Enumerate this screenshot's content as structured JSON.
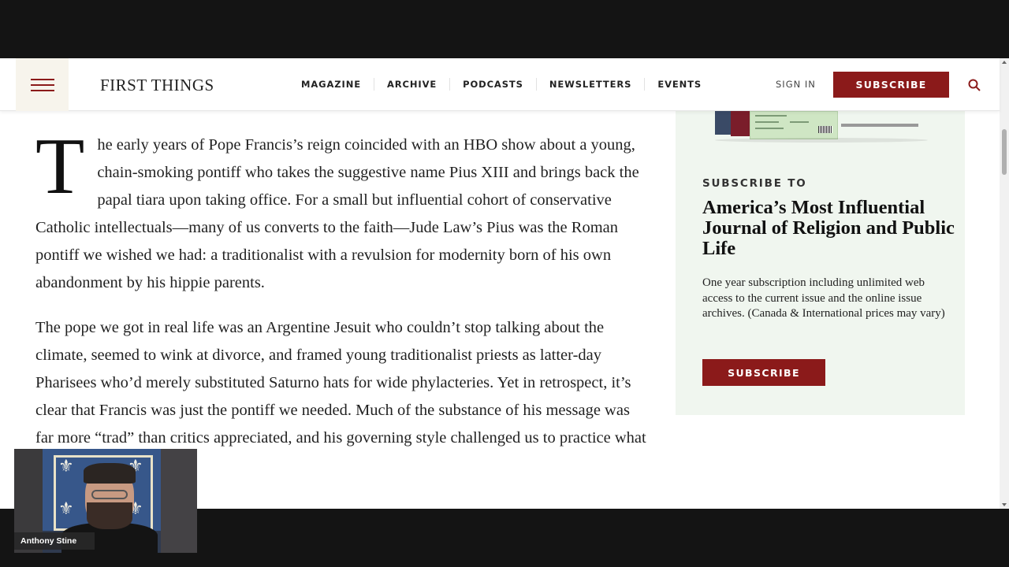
{
  "header": {
    "logo": "FIRST THINGS",
    "nav": [
      "MAGAZINE",
      "ARCHIVE",
      "PODCASTS",
      "NEWSLETTERS",
      "EVENTS"
    ],
    "signin": "SIGN IN",
    "subscribe": "SUBSCRIBE"
  },
  "article": {
    "dropcap": "T",
    "p1_rest": "he early years of Pope Francis’s reign coincided with an HBO show about a young, chain-smoking pontiff who takes the suggestive name Pius XIII and brings back the papal tiara upon taking office. For a small but influential cohort of conservative Catholic intellectuals—many of us converts to the faith—Jude Law’s Pius was the Roman pontiff we wished we had: a traditionalist with a revulsion for modernity born of his own abandonment by his hippie parents.",
    "p2": "The pope we got in real life was an Argentine Jesuit who couldn’t stop talking about the climate, seemed to wink at divorce, and framed young traditionalist priests as latter-day Pharisees who’d merely substituted Saturno hats for wide phylacteries. Yet in retrospect, it’s clear that Francis was just the pontiff we needed. Much of the substance of his message was far more “trad” than critics appreciated, and his governing style challenged us to practice what we"
  },
  "sidebar": {
    "kicker": "SUBSCRIBE TO",
    "title": "America’s Most Influential Journal of Religion and Public Life",
    "description": "One year subscription including unlimited web access to the current issue and the online issue archives. (Canada & International prices may vary)",
    "button": "SUBSCRIBE"
  },
  "webcam": {
    "name": "Anthony Stine"
  },
  "colors": {
    "accent": "#8b1a1a",
    "sidebar_bg": "#f0f6ef"
  }
}
